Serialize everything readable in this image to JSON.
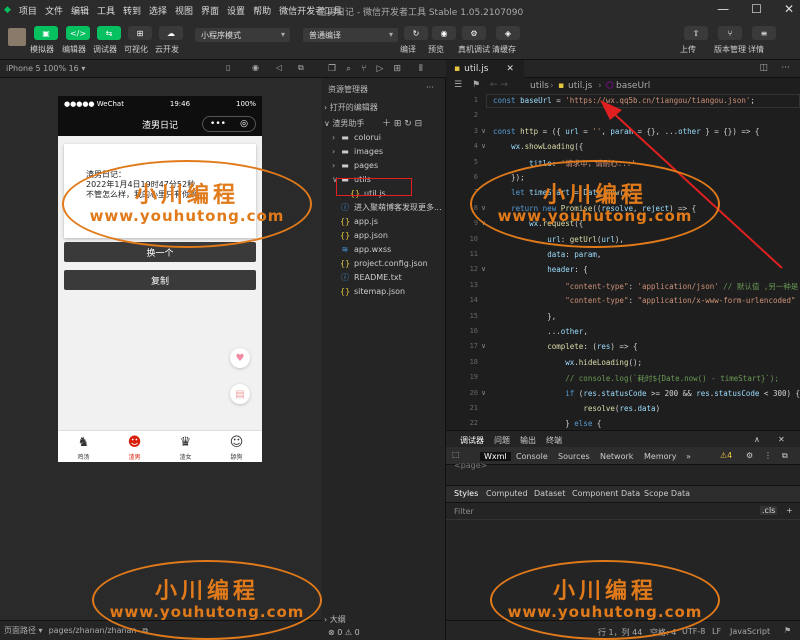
{
  "menubar": {
    "items": [
      "项目",
      "文件",
      "编辑",
      "工具",
      "转到",
      "选择",
      "视图",
      "界面",
      "设置",
      "帮助",
      "微信开发者工具"
    ],
    "title": "渣男日记 - 微信开发者工具 Stable 1.05.2107090",
    "win": [
      "—",
      "☐",
      "✕"
    ]
  },
  "toolbar": {
    "left_buttons": [
      {
        "label": "模拟器",
        "glyph": "▣"
      },
      {
        "label": "编辑器",
        "glyph": "</>"
      },
      {
        "label": "调试器",
        "glyph": "⇆"
      },
      {
        "label": "可视化",
        "glyph": "⊞"
      },
      {
        "label": "云开发",
        "glyph": "☁"
      }
    ],
    "mode_select": "小程序模式",
    "compile_select": "普通编译",
    "mid_buttons": [
      {
        "label": "编译",
        "glyph": "↻"
      },
      {
        "label": "预览",
        "glyph": "◉"
      },
      {
        "label": "真机调试",
        "glyph": "⚙"
      },
      {
        "label": "清缓存",
        "glyph": "◈"
      }
    ],
    "right_buttons": [
      {
        "label": "上传",
        "glyph": "⇧"
      },
      {
        "label": "版本管理",
        "glyph": "⑂"
      },
      {
        "label": "详情",
        "glyph": "≡"
      }
    ]
  },
  "simulator": {
    "device": "iPhone 5 100% 16 ▾",
    "status_left": "●●●●● WeChat",
    "status_time": "19:46",
    "status_right": "100%",
    "nav_title": "渣男日记",
    "card_lines": [
      "渣男日记：",
      "2022年1月4日19时47分52秒",
      "不管怎么样，我的心里只有你啊。"
    ],
    "btn_change": "换一个",
    "btn_copy": "复制",
    "tabs": [
      {
        "label": "鸡汤",
        "icon": "♞"
      },
      {
        "label": "渣男",
        "icon": "☻"
      },
      {
        "label": "渣女",
        "icon": "♛"
      },
      {
        "label": "舔狗",
        "icon": "☺"
      }
    ],
    "path_label": "页面路径 ▾",
    "path": "pages/zhanan/zhanan"
  },
  "explorer": {
    "title": "资源管理器",
    "open_editors": "› 打开的编辑器",
    "project": "∨ 渣男助手",
    "tree": [
      {
        "name": "colorui",
        "kind": "folder",
        "depth": 1,
        "arrow": "›"
      },
      {
        "name": "images",
        "kind": "folder",
        "depth": 1,
        "arrow": "›"
      },
      {
        "name": "pages",
        "kind": "folder",
        "depth": 1,
        "arrow": "›"
      },
      {
        "name": "utils",
        "kind": "folder",
        "depth": 1,
        "arrow": "∨"
      },
      {
        "name": "util.js",
        "kind": "js",
        "depth": 2,
        "arrow": ""
      },
      {
        "name": "进入聚萌博客发现更多...",
        "kind": "md",
        "depth": 1,
        "arrow": ""
      },
      {
        "name": "app.js",
        "kind": "js",
        "depth": 1,
        "arrow": ""
      },
      {
        "name": "app.json",
        "kind": "json",
        "depth": 1,
        "arrow": ""
      },
      {
        "name": "app.wxss",
        "kind": "wxss",
        "depth": 1,
        "arrow": ""
      },
      {
        "name": "project.config.json",
        "kind": "json",
        "depth": 1,
        "arrow": ""
      },
      {
        "name": "README.txt",
        "kind": "md",
        "depth": 1,
        "arrow": ""
      },
      {
        "name": "sitemap.json",
        "kind": "json",
        "depth": 1,
        "arrow": ""
      }
    ],
    "outline": "› 大纲",
    "problems": "⊗ 0  ⚠ 0"
  },
  "editor": {
    "tab": "util.js",
    "crumbs": [
      "utils",
      "util.js",
      "baseUrl"
    ],
    "lines": [
      {
        "n": "1",
        "html": "<span class='kw'>const</span> <span class='vr'>baseUrl</span> = <span class='st'>'https://wx.qq5b.cn/tiangou/tiangou.json'</span>;"
      },
      {
        "n": "2",
        "html": ""
      },
      {
        "n": "3",
        "html": "<span class='kw'>const</span> <span class='fn'>http</span> = ({ <span class='vr'>url</span> = <span class='st'>''</span>, <span class='vr'>param</span> = {}, ...<span class='vr'>other</span> } = {}) =&gt; {"
      },
      {
        "n": "4",
        "html": "    <span class='vr'>wx</span>.<span class='fn'>showLoading</span>({"
      },
      {
        "n": "5",
        "html": "        <span class='vr'>title</span>: <span class='st'>'请求中，请耐心...'</span>"
      },
      {
        "n": "6",
        "html": "    });"
      },
      {
        "n": "7",
        "html": "    <span class='kw'>let</span> <span class='vr'>timeStart</span> = <span class='vr'>Date</span>.<span class='fn'>now</span>();"
      },
      {
        "n": "8",
        "html": "    <span class='kw'>return new</span> <span class='fn'>Promise</span>((<span class='vr'>resolve</span>, <span class='vr'>reject</span>) =&gt; {"
      },
      {
        "n": "9",
        "html": "        <span class='vr'>wx</span>.<span class='fn'>request</span>({"
      },
      {
        "n": "10",
        "html": "            <span class='vr'>url</span>: <span class='fn'>getUrl</span>(<span class='vr'>url</span>),"
      },
      {
        "n": "11",
        "html": "            <span class='vr'>data</span>: <span class='vr'>param</span>,"
      },
      {
        "n": "12",
        "html": "            <span class='vr'>header</span>: {"
      },
      {
        "n": "13",
        "html": "                <span class='st'>\"content-type\"</span>: <span class='st'>'application/json'</span> <span class='cm'>// 默认值 ,另一种是</span>"
      },
      {
        "n": "14",
        "html": "                <span class='st'>\"content-type\"</span>: <span class='st'>\"application/x-www-form-urlencoded\"</span>"
      },
      {
        "n": "15",
        "html": "            },"
      },
      {
        "n": "16",
        "html": "            ...<span class='vr'>other</span>,"
      },
      {
        "n": "17",
        "html": "            <span class='fn'>complete</span>: (<span class='vr'>res</span>) =&gt; {"
      },
      {
        "n": "18",
        "html": "                <span class='vr'>wx</span>.<span class='fn'>hideLoading</span>();"
      },
      {
        "n": "19",
        "html": "                <span class='cm'>// console.log(`耗时${Date.now() - timeStart}`);</span>"
      },
      {
        "n": "20",
        "html": "                <span class='kw'>if</span> (<span class='vr'>res</span>.<span class='vr'>statusCode</span> &gt;= 200 &amp;&amp; <span class='vr'>res</span>.<span class='vr'>statusCode</span> &lt; 300) {"
      },
      {
        "n": "21",
        "html": "                    <span class='fn'>resolve</span>(<span class='vr'>res</span>.<span class='vr'>data</span>)"
      },
      {
        "n": "22",
        "html": "                } <span class='kw'>else</span> {"
      }
    ]
  },
  "devtools": {
    "top_tabs": [
      "调试器",
      "问题",
      "输出",
      "终端"
    ],
    "panel_tabs": [
      "Wxml",
      "Console",
      "Sources",
      "Network",
      "Memory",
      "»"
    ],
    "warn": "⚠4",
    "sub_tabs": [
      "Styles",
      "Computed",
      "Dataset",
      "Component Data",
      "Scope Data"
    ],
    "filter": "Filter",
    "cls": ".cls",
    "plus": "+",
    "faded": "<page>"
  },
  "statusbar": {
    "pos": "行 1，列 44",
    "spaces": "空格: 4",
    "enc": "UTF-8",
    "eol": "LF",
    "lang": "JavaScript"
  },
  "watermark": {
    "cn": "小川编程",
    "url": "www.youhutong.com"
  },
  "colors": {
    "accent": "#07c160",
    "highlight": "#e02020",
    "watermark": "#e07a1a"
  }
}
